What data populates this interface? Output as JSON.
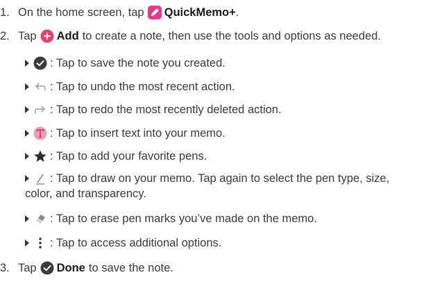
{
  "steps": [
    {
      "num": "1.",
      "pre": "On the home screen, tap",
      "strong": "QuickMemo+",
      "post": "."
    },
    {
      "num": "2.",
      "pre": "Tap",
      "strong": "Add",
      "post": "to create a note, then use the tools and options as needed."
    },
    {
      "num": "3.",
      "pre": "Tap",
      "strong": "Done",
      "post": "to save the note."
    }
  ],
  "tools": [
    {
      "icon": "check-circle-icon",
      "text": ": Tap to save the note you created."
    },
    {
      "icon": "undo-icon",
      "text": ": Tap to undo the most recent action."
    },
    {
      "icon": "redo-icon",
      "text": ": Tap to redo the most recently deleted action."
    },
    {
      "icon": "text-icon",
      "text": ": Tap to insert text into your memo."
    },
    {
      "icon": "star-icon",
      "text": ": Tap to add your favorite pens."
    },
    {
      "icon": "pen-icon",
      "text": ": Tap to draw on your memo. Tap again to select the pen type, size,",
      "cont": "color, and transparency."
    },
    {
      "icon": "eraser-icon",
      "text": ": Tap to erase pen marks you’ve made on the memo."
    },
    {
      "icon": "more-options-icon",
      "text": ": Tap to access additional options."
    }
  ],
  "colors": {
    "quickmemo_accent": "#e8398a",
    "add_accent": "#ee3f6b",
    "check_dark": "#3b3b3b",
    "text_icon_pink": "#e6a0b8",
    "text_icon_red": "#e03a5a"
  }
}
